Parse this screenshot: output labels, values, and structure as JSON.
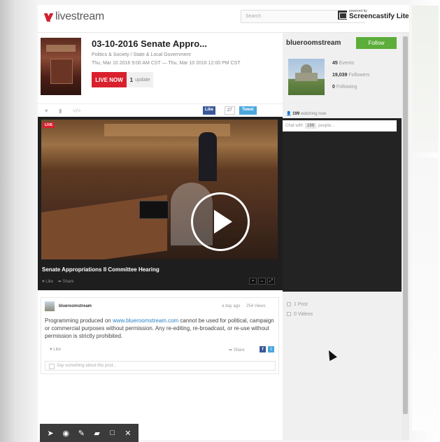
{
  "header": {
    "logo_text": "livestream",
    "search_placeholder": "Search",
    "screencastify_small": "powered by",
    "screencastify_big": "Screencastify Lite"
  },
  "event": {
    "title": "03-10-2016 Senate Appro...",
    "category": "Politics & Society / State & Local Government",
    "date": "Thu, Mar 10 2016 9:00 AM CST — Thu, Mar 10 2016 12:00 PM CST",
    "live_button": "LIVE NOW",
    "update_count": "1",
    "update_label": "update"
  },
  "share_bar": {
    "fb_like": "Like",
    "fb_count": "27",
    "tweet": "Tweet"
  },
  "channel": {
    "name": "blueroomstream",
    "follow_button": "Follow",
    "events_count": "45",
    "events_label": "Events",
    "followers_count": "19,039",
    "followers_label": "Followers",
    "following_count": "0",
    "following_label": "Following",
    "watching_count": "199",
    "watching_label": "watching now"
  },
  "chat": {
    "prefix": "Chat with",
    "count": "199",
    "suffix": "people..."
  },
  "player": {
    "live_tag": "LIVE",
    "title": "Senate Appropriations II Committee Hearing",
    "like": "Like",
    "share": "Share"
  },
  "side_links": {
    "posts": "1 Post",
    "videos": "0 Videos"
  },
  "post": {
    "author": "blueroomstream",
    "time": "a day ago",
    "views": "254 Views",
    "text_before": "Programming produced on ",
    "link": "www.blueroomstream.com",
    "text_after": " cannot be used for political, campaign or commercial purposes without permission. Any re-editing, re-broadcast, or re-use without permission is strictly prohibited.",
    "like": "Like",
    "share": "Share",
    "comment_placeholder": "Say something about this post..."
  }
}
